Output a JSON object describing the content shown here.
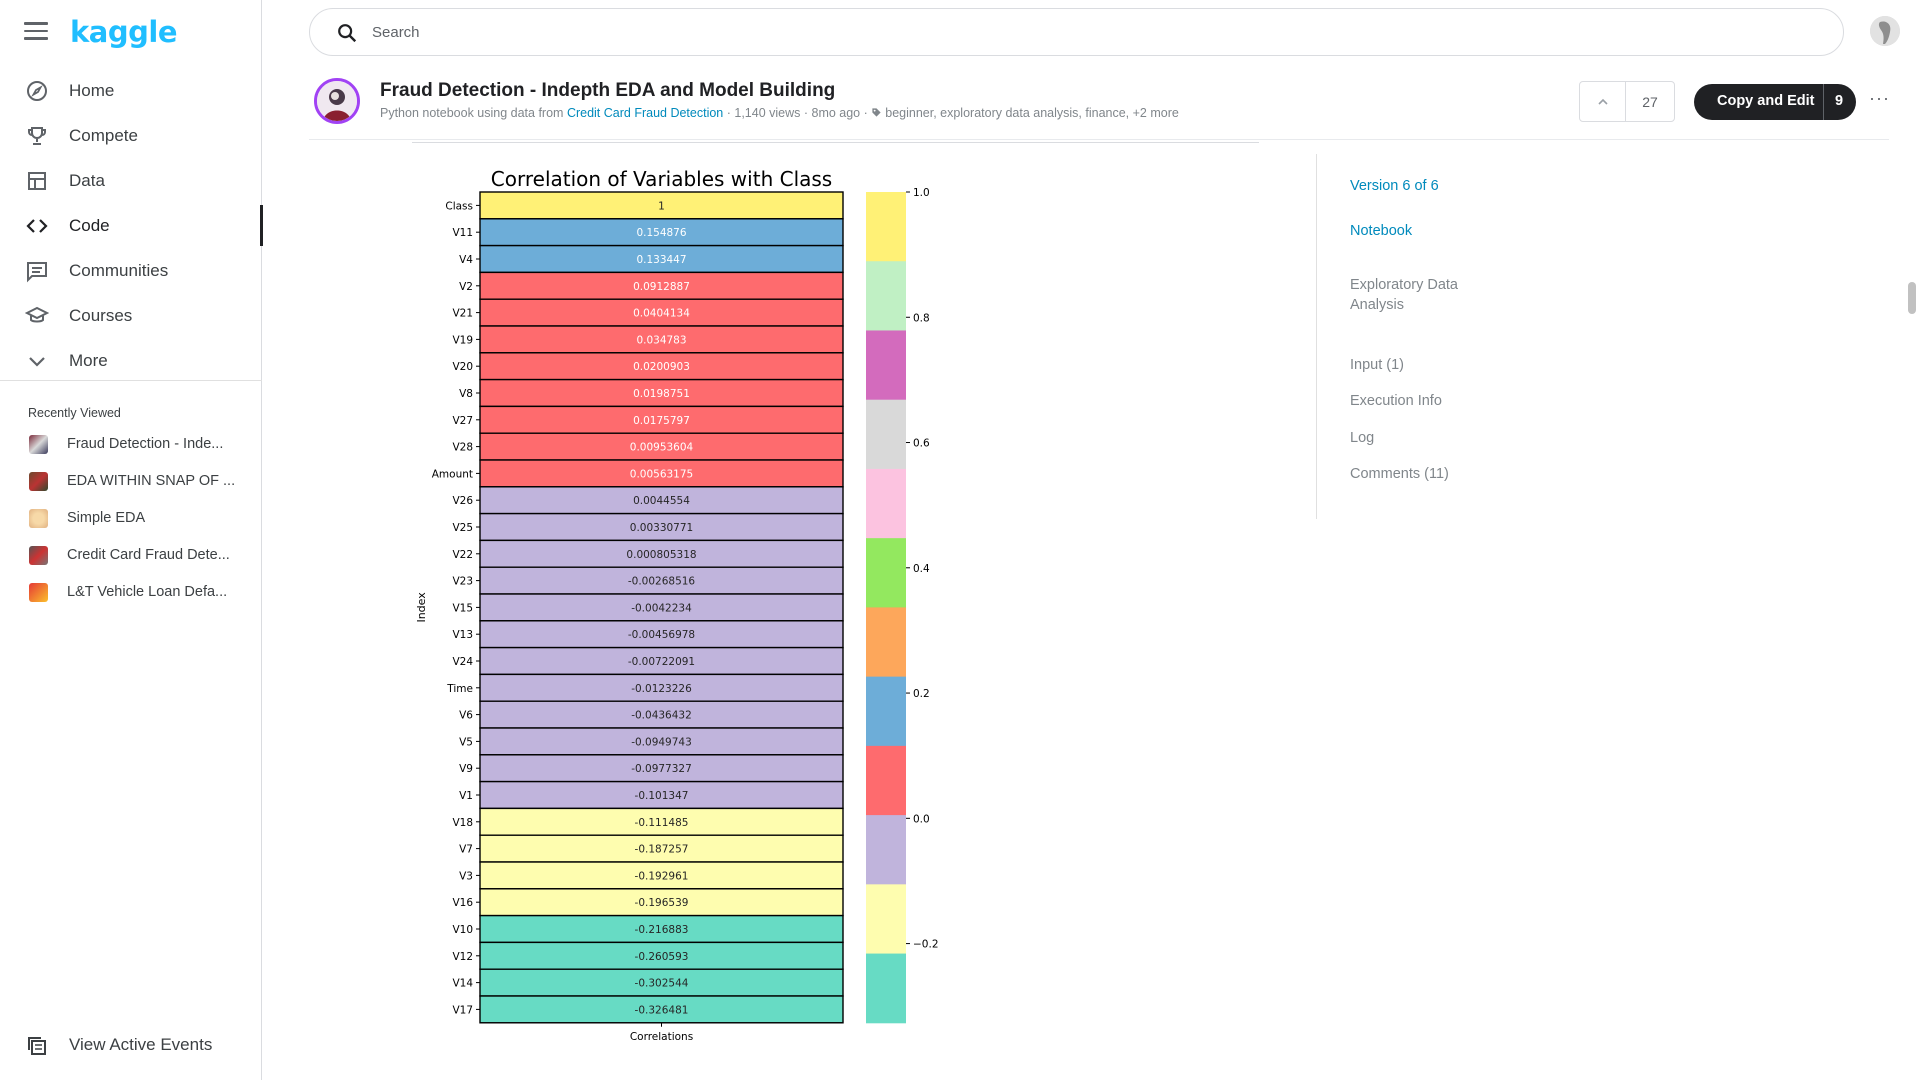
{
  "sidebar": {
    "logo": "kaggle",
    "items": [
      {
        "label": "Home",
        "icon": "compass-icon"
      },
      {
        "label": "Compete",
        "icon": "trophy-icon"
      },
      {
        "label": "Data",
        "icon": "table-icon"
      },
      {
        "label": "Code",
        "icon": "code-icon",
        "active": true
      },
      {
        "label": "Communities",
        "icon": "comment-icon"
      },
      {
        "label": "Courses",
        "icon": "school-icon"
      },
      {
        "label": "More",
        "icon": "chevron-down-icon"
      }
    ],
    "recent_heading": "Recently Viewed",
    "recent": [
      {
        "label": "Fraud Detection - Inde..."
      },
      {
        "label": "EDA WITHIN SNAP OF ..."
      },
      {
        "label": "Simple EDA"
      },
      {
        "label": "Credit Card Fraud Dete..."
      },
      {
        "label": "L&T Vehicle Loan Defa..."
      }
    ],
    "active_events": "View Active Events"
  },
  "search": {
    "placeholder": "Search"
  },
  "notebook": {
    "title": "Fraud Detection - Indepth EDA and Model Building",
    "meta_prefix": "Python notebook using data from ",
    "meta_link": "Credit Card Fraud Detection",
    "meta_suffix": " · 1,140 views · 8mo ago · ",
    "tags": "beginner, exploratory data analysis, finance, +2 more",
    "votes": "27",
    "copy_label": "Copy and Edit",
    "copy_count": "9"
  },
  "toc": {
    "version": "Version 6 of 6",
    "notebook": "Notebook",
    "section": "Exploratory Data Analysis",
    "input": "Input (1)",
    "exec": "Execution Info",
    "log": "Log",
    "comments": "Comments (11)"
  },
  "chart_data": {
    "type": "heatmap",
    "title": "Correlation of Variables with Class",
    "ylabel": "Index",
    "xlabel": "",
    "categories": [
      "Correlations"
    ],
    "rows": [
      "Class",
      "V11",
      "V4",
      "V2",
      "V21",
      "V19",
      "V20",
      "V8",
      "V27",
      "V28",
      "Amount",
      "V26",
      "V25",
      "V22",
      "V23",
      "V15",
      "V13",
      "V24",
      "Time",
      "V6",
      "V5",
      "V9",
      "V1",
      "V18",
      "V7",
      "V3",
      "V16",
      "V10",
      "V12",
      "V14",
      "V17"
    ],
    "values": [
      1,
      0.154876,
      0.133447,
      0.0912887,
      0.0404134,
      0.034783,
      0.0200903,
      0.0198751,
      0.0175797,
      0.00953604,
      0.00563175,
      0.0044554,
      0.00330771,
      0.000805318,
      -0.00268516,
      -0.0042234,
      -0.00456978,
      -0.00722091,
      -0.0123226,
      -0.0436432,
      -0.0949743,
      -0.0977327,
      -0.101347,
      -0.111485,
      -0.187257,
      -0.192961,
      -0.196539,
      -0.216883,
      -0.260593,
      -0.302544,
      -0.326481
    ],
    "labels": [
      "1",
      "0.154876",
      "0.133447",
      "0.0912887",
      "0.0404134",
      "0.034783",
      "0.0200903",
      "0.0198751",
      "0.0175797",
      "0.00953604",
      "0.00563175",
      "0.0044554",
      "0.00330771",
      "0.000805318",
      "-0.00268516",
      "-0.0042234",
      "-0.00456978",
      "-0.00722091",
      "-0.0123226",
      "-0.0436432",
      "-0.0949743",
      "-0.0977327",
      "-0.101347",
      "-0.111485",
      "-0.187257",
      "-0.192961",
      "-0.196539",
      "-0.216883",
      "-0.260593",
      "-0.302544",
      "-0.326481"
    ],
    "colorbar": {
      "range": [
        -0.326481,
        1.0
      ],
      "ticks": [
        1.0,
        0.8,
        0.6,
        0.4,
        0.2,
        0.0,
        -0.2
      ],
      "tick_labels": [
        "1.0",
        "0.8",
        "0.6",
        "0.4",
        "0.2",
        "0.0",
        "−0.2"
      ],
      "colors": [
        "#fff176",
        "#c0f0c4",
        "#d36bbd",
        "#d9d9d9",
        "#fcc3e0",
        "#93e85f",
        "#fda75b",
        "#6dadd8",
        "#fe6b6e",
        "#c0b4dc",
        "#fefdaf",
        "#67dbc4"
      ]
    },
    "legend": "none",
    "grid": false
  }
}
